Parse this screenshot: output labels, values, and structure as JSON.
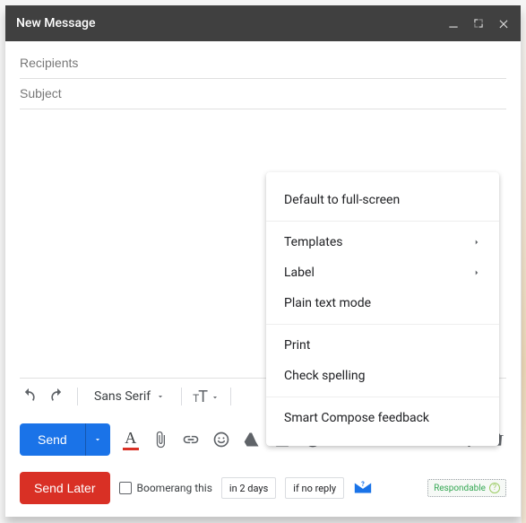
{
  "header": {
    "title": "New Message"
  },
  "fields": {
    "recipients_placeholder": "Recipients",
    "subject_placeholder": "Subject"
  },
  "toolbar": {
    "font_name": "Sans Serif",
    "send_label": "Send"
  },
  "boomerang": {
    "send_later_label": "Send Later",
    "checkbox_label": "Boomerang this",
    "delay_value": "in 2 days",
    "condition_value": "if no reply",
    "respondable_label": "Respondable"
  },
  "menu": {
    "default_fullscreen": "Default to full-screen",
    "templates": "Templates",
    "label": "Label",
    "plain_text": "Plain text mode",
    "print": "Print",
    "check_spelling": "Check spelling",
    "smart_compose_feedback": "Smart Compose feedback"
  }
}
